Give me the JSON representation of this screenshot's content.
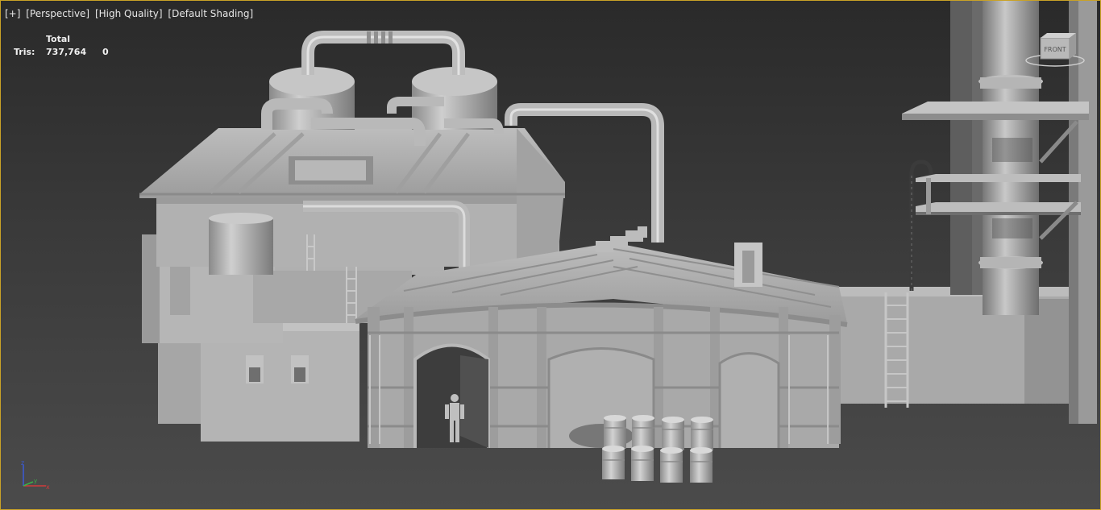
{
  "viewport": {
    "labels": [
      "[+]",
      "[Perspective]",
      "[High Quality]",
      "[Default Shading]"
    ]
  },
  "stats": {
    "header": "Total",
    "tris_label": "Tris:",
    "tris_total": "737,764",
    "tris_selected": "0"
  },
  "viewcube": {
    "face_label": "FRONT"
  },
  "axis_gizmo": {
    "x": "x",
    "y": "y",
    "z": "z"
  },
  "colors": {
    "viewport_border": "#c9a227",
    "background_top": "#2a2a2a",
    "background_bottom": "#4b4b4b",
    "model_grey": "#a8a8a8"
  }
}
